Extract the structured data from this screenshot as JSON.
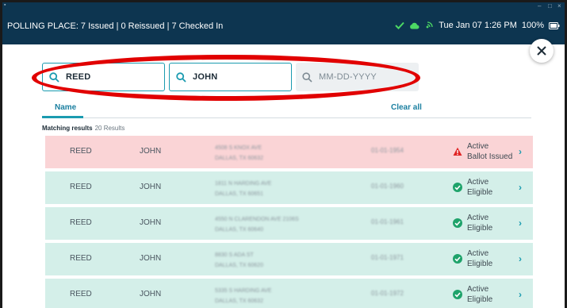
{
  "statusbar": {
    "title": "POLLING PLACE: 7 Issued | 0 Reissued | 7 Checked In",
    "datetime": "Tue Jan 07  1:26 PM",
    "battery": "100%"
  },
  "search": {
    "last_name": "REED",
    "first_name": "JOHN",
    "dob_placeholder": "MM-DD-YYYY"
  },
  "tabs": {
    "name_label": "Name",
    "clear_all": "Clear all"
  },
  "results": {
    "label": "Matching results",
    "count": "20 Results",
    "rows": [
      {
        "last": "REED",
        "first": "JOHN",
        "addr1": "4508 S KNOX AVE",
        "addr2": "DALLAS, TX 60632",
        "dob": "01-01-1954",
        "status1": "Active",
        "status2": "Ballot Issued",
        "kind": "alert"
      },
      {
        "last": "REED",
        "first": "JOHN",
        "addr1": "1811 N HARDING AVE",
        "addr2": "DALLAS, TX 60651",
        "dob": "01-01-1960",
        "status1": "Active",
        "status2": "Eligible",
        "kind": "ok"
      },
      {
        "last": "REED",
        "first": "JOHN",
        "addr1": "4550 N CLARENDON AVE  2106S",
        "addr2": "DALLAS, TX 60640",
        "dob": "01-01-1961",
        "status1": "Active",
        "status2": "Eligible",
        "kind": "ok"
      },
      {
        "last": "REED",
        "first": "JOHN",
        "addr1": "8830 S ADA ST",
        "addr2": "DALLAS, TX 60620",
        "dob": "01-01-1971",
        "status1": "Active",
        "status2": "Eligible",
        "kind": "ok"
      },
      {
        "last": "REED",
        "first": "JOHN",
        "addr1": "5335 S HARDING AVE",
        "addr2": "DALLAS, TX 60632",
        "dob": "01-01-1972",
        "status1": "Active",
        "status2": "Eligible",
        "kind": "ok"
      }
    ]
  },
  "colors": {
    "header": "#0d3550",
    "accent": "#1b9bb0",
    "alert_row": "#fad4d6",
    "ok_row": "#d4efe9",
    "annotation": "#e10000"
  }
}
